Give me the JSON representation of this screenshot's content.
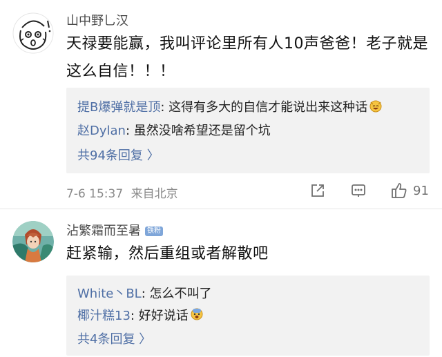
{
  "comments": [
    {
      "username": "山中野乚汉",
      "content": "天禄要能赢，我叫评论里所有人10声爸爸！老子就是这么自信！！！",
      "replies": [
        {
          "name": "提B爆弹就是顶",
          "text": ": 这得有多大的自信才能说出来这种话",
          "emoji": "laughing-face-emoji"
        },
        {
          "name": "赵Dylan",
          "text": ": 虽然没啥希望还是留个坑"
        }
      ],
      "more": "共94条回复 〉",
      "timestamp": "7-6 15:37",
      "location": "来自北京",
      "likes": "91"
    },
    {
      "username": "沾繁霜而至暑",
      "badge": "铁粉",
      "content": "赶紧输，然后重组或者解散吧",
      "replies": [
        {
          "name": "White丶BL",
          "text": ": 怎么不叫了"
        },
        {
          "name": "椰汁糕13",
          "text": ": 好好说话",
          "emoji": "fearful-face-emoji"
        }
      ],
      "more": "共4条回复 〉"
    }
  ],
  "icons": {
    "share": "share-icon",
    "comment": "comment-icon",
    "like": "thumbs-up-icon"
  },
  "colors": {
    "link": "#4f6fa5",
    "reply_bg": "#f2f2f2",
    "badge_bg": "#7fa6d9"
  }
}
